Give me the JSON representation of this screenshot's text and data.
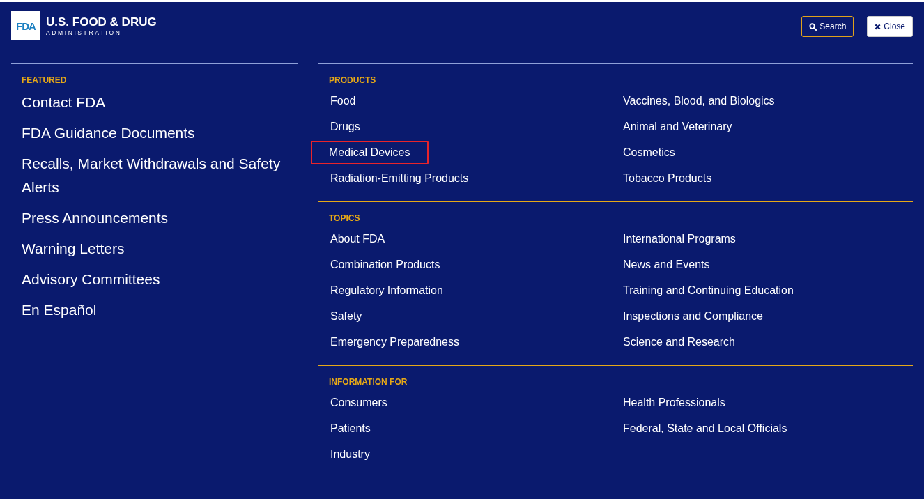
{
  "header": {
    "logo_mark": "FDA",
    "title": "U.S. FOOD & DRUG",
    "subtitle": "ADMINISTRATION"
  },
  "buttons": [
    {
      "kind": "search",
      "label": "Search"
    },
    {
      "kind": "close",
      "label": "Close"
    }
  ],
  "featured": {
    "heading": "FEATURED",
    "links": [
      "Contact FDA",
      "FDA Guidance Documents",
      "Recalls, Market Withdrawals and Safety Alerts",
      "Press Announcements",
      "Warning Letters",
      "Advisory Committees",
      "En Español"
    ]
  },
  "sections": [
    {
      "heading": "PRODUCTS",
      "links": [
        {
          "label": "Food",
          "highlighted": false
        },
        {
          "label": "Drugs",
          "highlighted": false
        },
        {
          "label": "Medical Devices",
          "highlighted": true
        },
        {
          "label": "Radiation-Emitting Products",
          "highlighted": false
        },
        {
          "label": "Vaccines, Blood, and Biologics",
          "highlighted": false
        },
        {
          "label": "Animal and Veterinary",
          "highlighted": false
        },
        {
          "label": "Cosmetics",
          "highlighted": false
        },
        {
          "label": "Tobacco Products",
          "highlighted": false
        }
      ]
    },
    {
      "heading": "TOPICS",
      "links": [
        {
          "label": "About FDA",
          "highlighted": false
        },
        {
          "label": "Combination Products",
          "highlighted": false
        },
        {
          "label": "Regulatory Information",
          "highlighted": false
        },
        {
          "label": "Safety",
          "highlighted": false
        },
        {
          "label": "Emergency Preparedness",
          "highlighted": false
        },
        {
          "label": "International Programs",
          "highlighted": false
        },
        {
          "label": "News and Events",
          "highlighted": false
        },
        {
          "label": "Training and Continuing Education",
          "highlighted": false
        },
        {
          "label": "Inspections and Compliance",
          "highlighted": false
        },
        {
          "label": "Science and Research",
          "highlighted": false
        }
      ]
    },
    {
      "heading": "INFORMATION FOR",
      "links": [
        {
          "label": "Consumers",
          "highlighted": false
        },
        {
          "label": "Patients",
          "highlighted": false
        },
        {
          "label": "Industry",
          "highlighted": false
        },
        {
          "label": "Health Professionals",
          "highlighted": false
        },
        {
          "label": "Federal, State and Local Officials",
          "highlighted": false
        }
      ]
    }
  ]
}
